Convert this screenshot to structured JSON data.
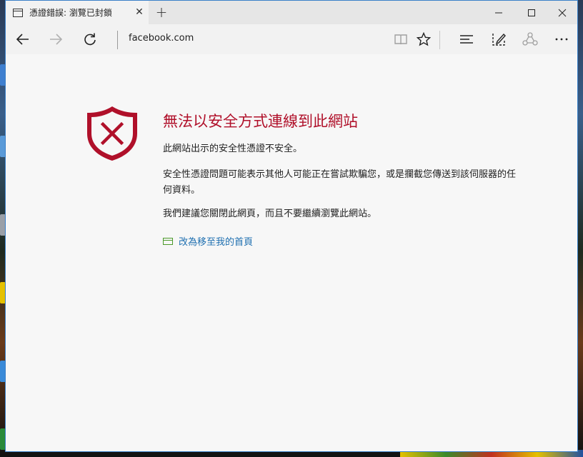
{
  "tab": {
    "title": "憑證錯誤: 瀏覽已封鎖",
    "close": "✕",
    "new_tab": "+"
  },
  "nav": {
    "address": "facebook.com"
  },
  "page": {
    "heading": "無法以安全方式連線到此網站",
    "para1": "此網站出示的安全性憑證不安全。",
    "para2": "安全性憑證問題可能表示其他人可能正在嘗試欺騙您，或是攔截您傳送到該伺服器的任何資料。",
    "para3": "我們建議您關閉此網頁，而且不要繼續瀏覽此網站。",
    "home_link": "改為移至我的首頁"
  },
  "colors": {
    "accent_red": "#b0102a",
    "link_blue": "#1e6fb0",
    "link_icon_green": "#4b9a2a",
    "window_border": "#3a80c8"
  }
}
